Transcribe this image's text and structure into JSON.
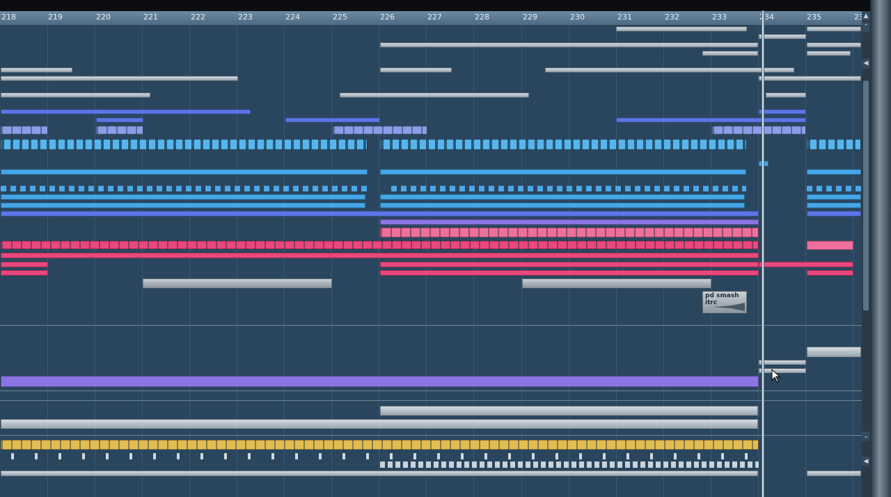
{
  "ruler": {
    "bars": [
      "218",
      "219",
      "220",
      "221",
      "222",
      "223",
      "224",
      "225",
      "226",
      "227",
      "228",
      "229",
      "230",
      "231",
      "232",
      "233",
      "234",
      "235",
      "23"
    ]
  },
  "clips": {
    "audio_clip_label": "pd smash itrc"
  },
  "icons": {
    "scroll_up": "chevron-up-icon",
    "scroll_down": "chevron-down-icon",
    "zoom_up": "triangle-up-icon",
    "zoom_down": "triangle-down-icon",
    "pointer": "mouse-pointer-icon"
  },
  "colors": {
    "background": "#2a465e",
    "ruler": "#5d7a93",
    "midi_grey": "#b8c3cc",
    "blue": "#5b77e6",
    "light_blue": "#44a6e8",
    "pink": "#e8487e",
    "violet": "#8b74e4",
    "gold": "#e2bd52"
  }
}
